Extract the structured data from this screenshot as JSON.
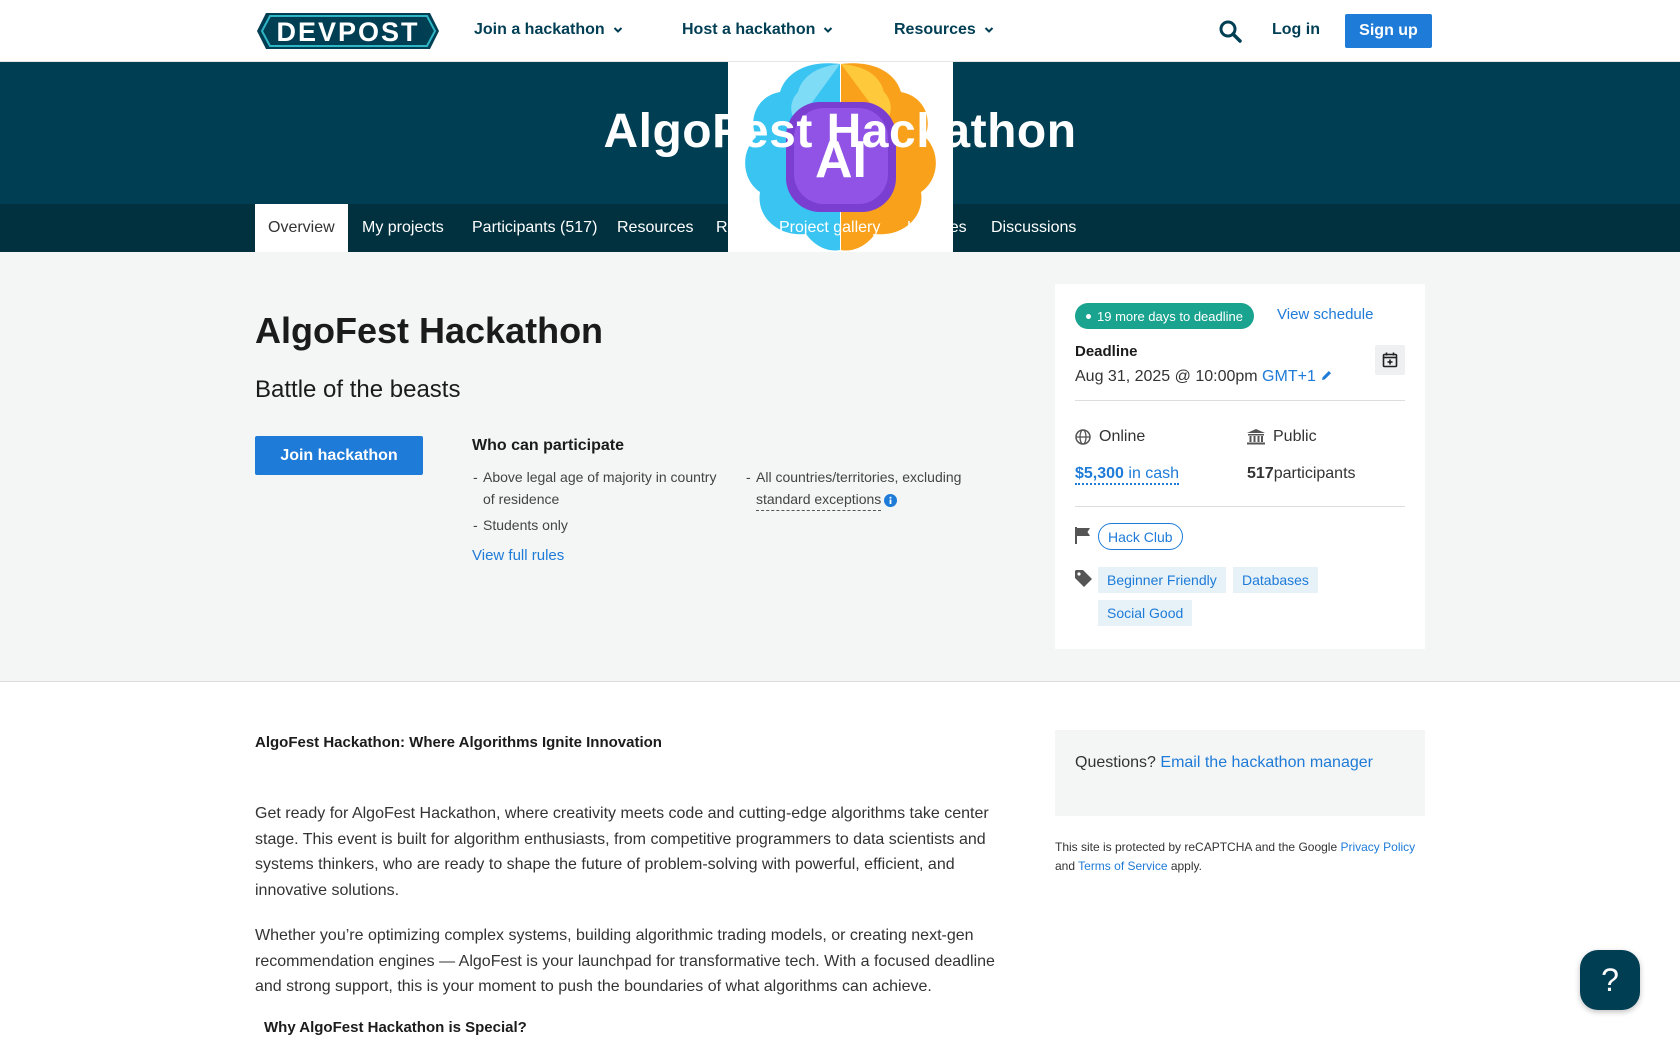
{
  "topnav": {
    "brand": "DEVPOST",
    "join": "Join a hackathon",
    "host": "Host a hackathon",
    "resources": "Resources",
    "login": "Log in",
    "signup": "Sign up"
  },
  "hero": {
    "title": "AlgoFest Hackathon",
    "logo_text": "AI"
  },
  "tabs": [
    {
      "label": "Overview",
      "active": true
    },
    {
      "label": "My projects"
    },
    {
      "label": "Participants (517)"
    },
    {
      "label": "Resources"
    },
    {
      "label": "Rules"
    },
    {
      "label": "Project gallery"
    },
    {
      "label": "Updates"
    },
    {
      "label": "Discussions"
    }
  ],
  "overview": {
    "title": "AlgoFest Hackathon",
    "tagline": "Battle of the beasts",
    "join_button": "Join hackathon",
    "who_title": "Who can participate",
    "who_items": [
      "Above legal age of majority in country",
      "of residence",
      "Students only",
      "All countries/territories, excluding",
      "standard exceptions"
    ],
    "view_rules": "View full rules"
  },
  "sidebar": {
    "days_badge": "19 more days to deadline",
    "view_schedule": "View schedule",
    "deadline_label": "Deadline",
    "deadline_date": "Aug 31, 2025 @ 10:00pm",
    "timezone": "GMT+1",
    "location": "Online",
    "visibility": "Public",
    "prize_amount": "$5,300",
    "prize_suffix": " in cash",
    "participants_count": "517",
    "participants_label": " participants",
    "host": "Hack Club",
    "tags": [
      "Beginner Friendly",
      "Databases",
      "Social Good"
    ]
  },
  "content": {
    "heading": "AlgoFest Hackathon: Where Algorithms Ignite Innovation",
    "p1": "Get ready for AlgoFest Hackathon, where creativity meets code and cutting-edge algorithms take center stage. This event is built for algorithm enthusiasts, from competitive programmers to data scientists and systems thinkers, who are ready to shape the future of problem-solving with powerful, efficient, and innovative solutions.",
    "p2": "Whether you’re optimizing complex systems, building algorithmic trading models, or creating next-gen recommendation engines — AlgoFest is your launchpad for transformative tech. With a focused deadline and strong support, this is your moment to push the boundaries of what algorithms can achieve.",
    "why": "Why AlgoFest Hackathon is Special?"
  },
  "questions": {
    "prefix": "Questions? ",
    "link": "Email the hackathon manager"
  },
  "recaptcha": {
    "text1": "This site is protected by reCAPTCHA and the Google ",
    "privacy": "Privacy Policy",
    "text2": "and ",
    "terms": "Terms of Service",
    "text3": " apply."
  },
  "help": {
    "label": "?"
  },
  "colors": {
    "brand_dark": "#003e54",
    "link_blue": "#1e7bd8",
    "badge_green": "#1aa38e"
  }
}
